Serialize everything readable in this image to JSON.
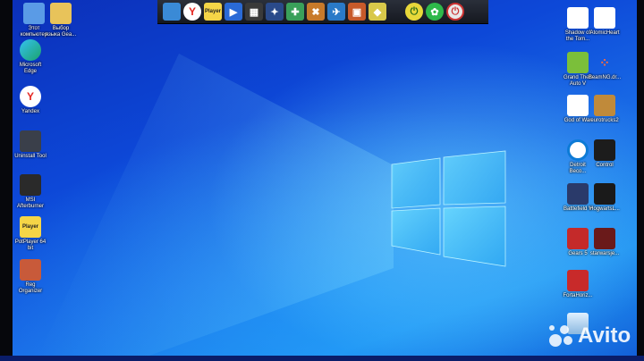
{
  "desktop_left": [
    {
      "name": "system-folder",
      "label": "Этот\nкомпьютер",
      "icon": "computer-icon",
      "color": "#5a9be6"
    },
    {
      "name": "language-folder",
      "label": "Выбор\nязыка Gea...",
      "icon": "folder-icon",
      "color": "#e8c35a"
    },
    {
      "name": "edge",
      "label": "Microsoft\nEdge",
      "icon": "edge-icon",
      "color": "#1ba36c"
    },
    {
      "name": "yandex",
      "label": "Yandex",
      "icon": "yandex-icon",
      "color": "#ffffff"
    },
    {
      "name": "uninstall-tool",
      "label": "Uninstall Tool",
      "icon": "uninstall-icon",
      "color": "#3a3f4a"
    },
    {
      "name": "msi-afterburner",
      "label": "MSI\nAfterburner",
      "icon": "afterburner-icon",
      "color": "#2a2a2a"
    },
    {
      "name": "potplayer",
      "label": "PotPlayer 64\nbit",
      "icon": "player-icon",
      "color": "#f5d547",
      "glyph_text": "Player"
    },
    {
      "name": "reg-organizer",
      "label": "Reg\nOrganizer",
      "icon": "reg-icon",
      "color": "#c85a3a"
    }
  ],
  "desktop_right": [
    {
      "name": "shadow-tomb-raider",
      "label": "Shadow of\nthe Tom...",
      "icon": "tomb-raider-icon",
      "color": "#ffffff"
    },
    {
      "name": "atomic-heart",
      "label": "AtomicHeart",
      "icon": "atomic-heart-icon",
      "color": "#ffffff"
    },
    {
      "name": "gta-v",
      "label": "Grand Theft\nAuto V",
      "icon": "gta-icon",
      "color": "#7bbf3a"
    },
    {
      "name": "beamng",
      "label": "BeamNG.dr...",
      "icon": "beamng-icon",
      "color": "#ff6a3a"
    },
    {
      "name": "god-of-war",
      "label": "God of War",
      "icon": "god-of-war-icon",
      "color": "#ffffff"
    },
    {
      "name": "eurotrucks2",
      "label": "eurotrucks2",
      "icon": "eurotrucks-icon",
      "color": "#c08a3a"
    },
    {
      "name": "detroit",
      "label": "Detroit\nBeco...",
      "icon": "detroit-icon",
      "color": "#0d7bd6"
    },
    {
      "name": "control",
      "label": "Control",
      "icon": "control-icon",
      "color": "#1c1c1c"
    },
    {
      "name": "battlefield-v",
      "label": "Battlefield V",
      "icon": "battlefield-icon",
      "color": "#2a3a6a"
    },
    {
      "name": "hogwarts-legacy",
      "label": "HogwartsL...",
      "icon": "hogwarts-icon",
      "color": "#1a1a1a"
    },
    {
      "name": "gears-5",
      "label": "Gears 5",
      "icon": "gears-icon",
      "color": "#c42a2a"
    },
    {
      "name": "star-wars-jedi",
      "label": "starwarsje...",
      "icon": "jedi-icon",
      "color": "#6a1a1a"
    },
    {
      "name": "forza-horizon",
      "label": "FortaHoriz...",
      "icon": "forza-icon",
      "color": "#c82a2a"
    },
    {
      "name": "recycle-bin",
      "label": "",
      "icon": "recycle-bin-icon",
      "color": "#b8d8f0"
    }
  ],
  "launchbar": {
    "items": [
      {
        "name": "lb-app-1",
        "icon": "monitor-icon",
        "color": "#3a8ad6",
        "text": ""
      },
      {
        "name": "lb-yandex",
        "icon": "yandex-icon",
        "color": "#ffffff",
        "text": "Y"
      },
      {
        "name": "lb-potplayer",
        "icon": "player-icon",
        "color": "#f5d547",
        "text": "Player"
      },
      {
        "name": "lb-media",
        "icon": "media-icon",
        "color": "#2a6ad6",
        "text": "▶"
      },
      {
        "name": "lb-calc",
        "icon": "calculator-icon",
        "color": "#3a3a3a",
        "text": "▦"
      },
      {
        "name": "lb-app-6",
        "icon": "app-icon",
        "color": "#2a4a8a",
        "text": "✦"
      },
      {
        "name": "lb-app-7",
        "icon": "app-icon",
        "color": "#3aa05a",
        "text": "✚"
      },
      {
        "name": "lb-app-8",
        "icon": "tools-icon",
        "color": "#c87a2a",
        "text": "✖"
      },
      {
        "name": "lb-app-9",
        "icon": "app-icon",
        "color": "#2a7ac8",
        "text": "✈"
      },
      {
        "name": "lb-app-10",
        "icon": "app-icon",
        "color": "#c85a2a",
        "text": "▣"
      },
      {
        "name": "lb-app-11",
        "icon": "app-icon",
        "color": "#d8c84a",
        "text": "◆"
      },
      {
        "name": "lb-sleep",
        "icon": "sleep-icon",
        "color": "#e8d83a",
        "text": "⏻"
      },
      {
        "name": "lb-restart",
        "icon": "restart-icon",
        "color": "#2eb84a",
        "text": "✿"
      },
      {
        "name": "lb-shutdown",
        "icon": "power-icon",
        "color": "#e8e8e8",
        "text": "⏻"
      }
    ]
  },
  "watermark": {
    "text": "Avito"
  }
}
